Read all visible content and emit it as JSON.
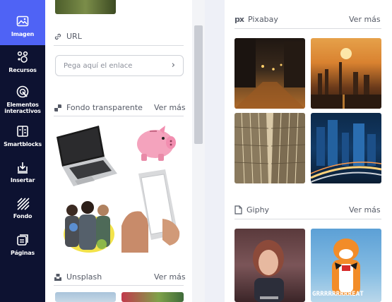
{
  "sidebar": {
    "items": [
      {
        "label": "Imagen",
        "icon": "image-icon",
        "active": true
      },
      {
        "label": "Recursos",
        "icon": "shapes-icon"
      },
      {
        "label": "Elementos interactivos",
        "icon": "cursor-click-icon"
      },
      {
        "label": "Smartblocks",
        "icon": "smartblocks-icon"
      },
      {
        "label": "Insertar",
        "icon": "insert-icon"
      },
      {
        "label": "Fondo",
        "icon": "background-icon"
      },
      {
        "label": "Páginas",
        "icon": "pages-icon"
      }
    ]
  },
  "url_section": {
    "title": "URL",
    "placeholder": "Pega aquí el enlace",
    "arrow": "›"
  },
  "transparent_section": {
    "title": "Fondo transparente",
    "see_more": "Ver más"
  },
  "unsplash_section": {
    "title": "Unsplash",
    "see_more": "Ver más"
  },
  "pixabay_section": {
    "title": "Pixabay",
    "logo": "px",
    "see_more": "Ver más"
  },
  "giphy_section": {
    "title": "Giphy",
    "see_more": "Ver más",
    "gif_caption": "GRRRRRRRRREAT"
  },
  "colors": {
    "rail_bg": "#0d1231",
    "active": "#4f63f5"
  }
}
